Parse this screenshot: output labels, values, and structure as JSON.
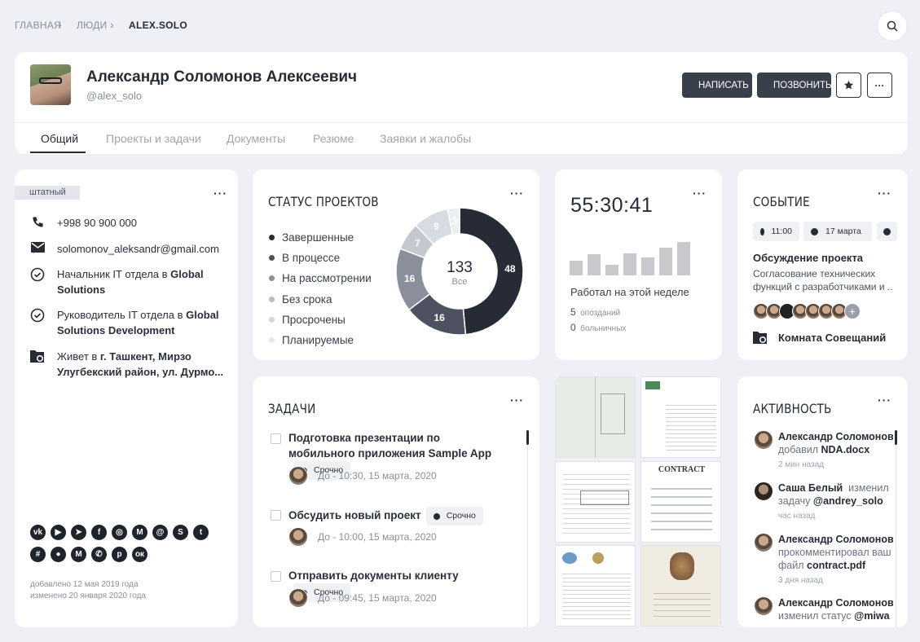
{
  "breadcrumb": {
    "home": "ГЛАВНАЯ",
    "people": "ЛЮДИ",
    "current": "ALEX.SOLO"
  },
  "profile": {
    "name": "Александр Соломонов Алексеевич",
    "username": "@alex_solo"
  },
  "actions": {
    "write": "НАПИСАТЬ",
    "call": "ПОЗВОНИТЬ"
  },
  "tabs": [
    "Общий",
    "Проекты и задачи",
    "Документы",
    "Резюме",
    "Заявки и жалобы"
  ],
  "info": {
    "badge": "штатный",
    "phone": "+998 90 900 000",
    "email": "solomonov_aleksandr@gmail.com",
    "position1_prefix": "Начальник IT отдела в ",
    "position1_org": "Global Solutions",
    "position2_prefix": "Руководитель IT отдела в ",
    "position2_org": "Global Solutions Development",
    "address_prefix": "Живет в ",
    "address": "г. Ташкент, Мирзо Улугбекский район, ул. Дурмо...",
    "added": "добавлено 12 мая 2019 года",
    "modified": "изменено 20 января 2020 года"
  },
  "social": [
    "vk",
    "youtube",
    "telegram",
    "facebook",
    "instagram",
    "medium",
    "mail",
    "skype",
    "twitter",
    "slack",
    "github",
    "gmail",
    "whatsapp",
    "pinterest",
    "odnoklassniki"
  ],
  "projects": {
    "title": "СТАТУС ПРОЕКТОВ",
    "total": "133",
    "total_label": "Все",
    "legend": [
      {
        "label": "Завершенные",
        "color": "#272b36"
      },
      {
        "label": "В процессе",
        "color": "#4d5160"
      },
      {
        "label": "На рассмотрении",
        "color": "#8b8f9c"
      },
      {
        "label": "Без срока",
        "color": "#b9bcc6"
      },
      {
        "label": "Просрочены",
        "color": "#d4d6de"
      },
      {
        "label": "Планируемые",
        "color": "#e7e8ee"
      }
    ]
  },
  "chart_data": {
    "type": "pie",
    "categories": [
      "Завершенные",
      "В процессе",
      "На рассмотрении",
      "Без срока",
      "Просрочены",
      "Планируемые"
    ],
    "values": [
      48,
      16,
      16,
      7,
      9,
      3
    ],
    "labels": [
      "48",
      "16",
      "16",
      "7",
      "9",
      "3"
    ],
    "colors": [
      "#272b36",
      "#4d5160",
      "#8b8f9c",
      "#c5c8d1",
      "#d9dbe2",
      "#eceef2"
    ]
  },
  "timer": {
    "time": "55:30:41",
    "caption": "Работал на этой неделе",
    "late_count": "5",
    "late_label": "опозданий",
    "sick_count": "0",
    "sick_label": "больничных",
    "bars": [
      0.3,
      0.43,
      0.21,
      0.45,
      0.37,
      0.56,
      0.68
    ]
  },
  "event": {
    "title": "СОБЫТИЕ",
    "time": "11:00",
    "date": "17 марта",
    "name": "Обсуждение проекта",
    "desc": "Согласование технических функций с разработчиками и ..",
    "room": "Комната Совещаний"
  },
  "tasks": {
    "title": "ЗАДАЧИ",
    "items": [
      {
        "title": "Подготовка презентации по мобильного приложения Sample App",
        "badge": "Срочно",
        "due": "До - 10:30, 15 марта, 2020"
      },
      {
        "title": "Обсудить новый проект",
        "badge": "Срочно",
        "due": "До - 10:00, 15 марта, 2020"
      },
      {
        "title": "Отправить документы клиенту",
        "badge": "Срочно",
        "due": "До - 09:45, 15 марта, 2020"
      }
    ]
  },
  "docs": {
    "contract": "CONTRACT"
  },
  "activity": {
    "title": "АКТИВНОСТЬ",
    "items": [
      {
        "user": "Александр Соломонов",
        "action": "добавил",
        "object": "NDA.docx",
        "time": "2 мин назад"
      },
      {
        "user": "Саша Белый",
        "action": "изменил задачу",
        "object": "@andrey_solo",
        "time": "час назад"
      },
      {
        "user": "Александр Соломонов",
        "action": "прокомментировал ваш файл",
        "object": "contract.pdf",
        "time": "3 дня назад"
      },
      {
        "user": "Александр Соломонов",
        "action": "изменил статус",
        "object": "@miwa",
        "time": ""
      }
    ]
  }
}
